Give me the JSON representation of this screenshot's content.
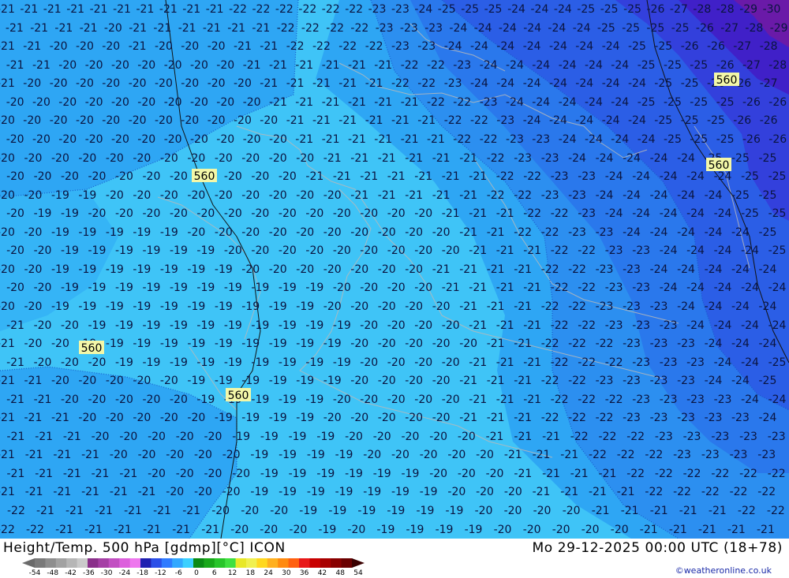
{
  "map": {
    "pressure_labels": [
      "560",
      "560",
      "560",
      "560",
      "560"
    ],
    "field_rows": [
      {
        "values": [
          -21,
          -21,
          -21,
          -21,
          -21,
          -21,
          -21,
          -21,
          -21,
          -21,
          -22,
          -22,
          -22,
          -22,
          -22,
          -22,
          -23,
          -23,
          -24,
          -25,
          -25,
          -25,
          -24,
          -24,
          -24,
          -25,
          -25,
          -25,
          -26,
          -27,
          -28,
          -28,
          -29,
          -30
        ]
      },
      {
        "values": [
          -21,
          -21,
          -21,
          -21,
          -20,
          -21,
          -21,
          -21,
          -21,
          -21,
          -21,
          -22,
          -22,
          -22,
          -22,
          -23,
          -23,
          -23,
          -24,
          -24,
          -24,
          -24,
          -24,
          -24,
          -25,
          -25,
          -25,
          -25,
          -26,
          -27,
          -28,
          -29
        ]
      },
      {
        "values": [
          -21,
          -21,
          -20,
          -20,
          -20,
          -21,
          -20,
          -20,
          -20,
          -21,
          -21,
          -22,
          -22,
          -22,
          -22,
          -23,
          -23,
          -24,
          -24,
          -24,
          -24,
          -24,
          -24,
          -24,
          -25,
          -25,
          -26,
          -26,
          -27,
          -28
        ]
      },
      {
        "values": [
          -21,
          -21,
          -20,
          -20,
          -20,
          -20,
          -20,
          -20,
          -20,
          -21,
          -21,
          -21,
          -21,
          -21,
          -21,
          -22,
          -22,
          -23,
          -24,
          -24,
          -24,
          -24,
          -24,
          -24,
          -25,
          -25,
          -25,
          -26,
          -27,
          -28
        ]
      },
      {
        "values": [
          -21,
          -20,
          -20,
          -20,
          -20,
          -20,
          -20,
          -20,
          -20,
          -20,
          -21,
          -21,
          -21,
          -21,
          -21,
          -22,
          -22,
          -23,
          -24,
          -24,
          -24,
          -24,
          -24,
          -24,
          -24,
          -25,
          -25,
          -26,
          -26,
          -27
        ]
      },
      {
        "values": [
          -20,
          -20,
          -20,
          -20,
          -20,
          -20,
          -20,
          -20,
          -20,
          -20,
          -21,
          -21,
          -21,
          -21,
          -21,
          -21,
          -22,
          -22,
          -23,
          -24,
          -24,
          -24,
          -24,
          -24,
          -25,
          -25,
          -25,
          -25,
          -26,
          -26
        ]
      },
      {
        "values": [
          -20,
          -20,
          -20,
          -20,
          -20,
          -20,
          -20,
          -20,
          -20,
          -20,
          -20,
          -21,
          -21,
          -21,
          -21,
          -21,
          -21,
          -22,
          -22,
          -23,
          -24,
          -24,
          -24,
          -24,
          -24,
          -25,
          -25,
          -25,
          -26,
          -26
        ]
      },
      {
        "values": [
          -20,
          -20,
          -20,
          -20,
          -20,
          -20,
          -20,
          -20,
          -20,
          -20,
          -20,
          -21,
          -21,
          -21,
          -21,
          -21,
          -21,
          -22,
          -22,
          -23,
          -23,
          -24,
          -24,
          -24,
          -24,
          -25,
          -25,
          -25,
          -26,
          -26
        ]
      },
      {
        "values": [
          -20,
          -20,
          -20,
          -20,
          -20,
          -20,
          -20,
          -20,
          -20,
          -20,
          -20,
          -20,
          -21,
          -21,
          -21,
          -21,
          -21,
          -21,
          -22,
          -23,
          -23,
          -24,
          -24,
          -24,
          -24,
          -24,
          -25,
          -25,
          -25
        ]
      },
      {
        "values": [
          -20,
          -20,
          -20,
          -20,
          -20,
          -20,
          -20,
          -20,
          -20,
          -20,
          -20,
          -21,
          -21,
          -21,
          -21,
          -21,
          -21,
          -21,
          -22,
          -22,
          -23,
          -23,
          -24,
          -24,
          -24,
          -24,
          -24,
          -25,
          -25
        ]
      },
      {
        "values": [
          -20,
          -20,
          -19,
          -19,
          -20,
          -20,
          -20,
          -20,
          -20,
          -20,
          -20,
          -20,
          -20,
          -21,
          -21,
          -21,
          -21,
          -21,
          -22,
          -22,
          -23,
          -23,
          -24,
          -24,
          -24,
          -24,
          -24,
          -25,
          -25
        ]
      },
      {
        "values": [
          -20,
          -19,
          -19,
          -20,
          -20,
          -20,
          -20,
          -20,
          -20,
          -20,
          -20,
          -20,
          -20,
          -20,
          -20,
          -20,
          -21,
          -21,
          -21,
          -22,
          -22,
          -23,
          -24,
          -24,
          -24,
          -24,
          -24,
          -25,
          -25
        ]
      },
      {
        "values": [
          -20,
          -20,
          -19,
          -19,
          -19,
          -19,
          -19,
          -20,
          -20,
          -20,
          -20,
          -20,
          -20,
          -20,
          -20,
          -20,
          -20,
          -21,
          -21,
          -22,
          -22,
          -23,
          -23,
          -24,
          -24,
          -24,
          -24,
          -24,
          -25
        ]
      },
      {
        "values": [
          -20,
          -20,
          -19,
          -19,
          -19,
          -19,
          -19,
          -19,
          -20,
          -20,
          -20,
          -20,
          -20,
          -20,
          -20,
          -20,
          -20,
          -21,
          -21,
          -21,
          -22,
          -22,
          -23,
          -23,
          -24,
          -24,
          -24,
          -24,
          -25
        ]
      },
      {
        "values": [
          -20,
          -20,
          -19,
          -19,
          -19,
          -19,
          -19,
          -19,
          -19,
          -20,
          -20,
          -20,
          -20,
          -20,
          -20,
          -20,
          -21,
          -21,
          -21,
          -21,
          -22,
          -22,
          -23,
          -23,
          -24,
          -24,
          -24,
          -24,
          -24
        ]
      },
      {
        "values": [
          -20,
          -20,
          -19,
          -19,
          -19,
          -19,
          -19,
          -19,
          -19,
          -19,
          -19,
          -19,
          -20,
          -20,
          -20,
          -20,
          -21,
          -21,
          -21,
          -21,
          -22,
          -22,
          -23,
          -23,
          -24,
          -24,
          -24,
          -24,
          -24
        ]
      },
      {
        "values": [
          -20,
          -20,
          -19,
          -19,
          -19,
          -19,
          -19,
          -19,
          -19,
          -19,
          -19,
          -19,
          -20,
          -20,
          -20,
          -20,
          -20,
          -21,
          -21,
          -21,
          -22,
          -22,
          -23,
          -23,
          -23,
          -24,
          -24,
          -24,
          -24
        ]
      },
      {
        "values": [
          -21,
          -20,
          -20,
          -19,
          -19,
          -19,
          -19,
          -19,
          -19,
          -19,
          -19,
          -19,
          -19,
          -20,
          -20,
          -20,
          -20,
          -21,
          -21,
          -21,
          -22,
          -22,
          -23,
          -23,
          -23,
          -24,
          -24,
          -24,
          -24
        ]
      },
      {
        "values": [
          -21,
          -20,
          -20,
          -19,
          -19,
          -19,
          -19,
          -19,
          -19,
          -19,
          -19,
          -19,
          -19,
          -20,
          -20,
          -20,
          -20,
          -20,
          -21,
          -21,
          -22,
          -22,
          -22,
          -23,
          -23,
          -23,
          -24,
          -24,
          -24
        ]
      },
      {
        "values": [
          -21,
          -20,
          -20,
          -20,
          -19,
          -19,
          -19,
          -19,
          -19,
          -19,
          -19,
          -19,
          -19,
          -20,
          -20,
          -20,
          -20,
          -21,
          -21,
          -21,
          -22,
          -22,
          -22,
          -23,
          -23,
          -23,
          -24,
          -24,
          -25
        ]
      },
      {
        "values": [
          -21,
          -21,
          -20,
          -20,
          -20,
          -20,
          -20,
          -19,
          -19,
          -19,
          -19,
          -19,
          -19,
          -20,
          -20,
          -20,
          -20,
          -21,
          -21,
          -21,
          -22,
          -22,
          -23,
          -23,
          -23,
          -23,
          -24,
          -24,
          -25
        ]
      },
      {
        "values": [
          -21,
          -21,
          -20,
          -20,
          -20,
          -20,
          -20,
          -19,
          -19,
          -19,
          -19,
          -19,
          -20,
          -20,
          -20,
          -20,
          -20,
          -21,
          -21,
          -21,
          -22,
          -22,
          -22,
          -23,
          -23,
          -23,
          -23,
          -24,
          -24
        ]
      },
      {
        "values": [
          -21,
          -21,
          -21,
          -20,
          -20,
          -20,
          -20,
          -20,
          -19,
          -19,
          -19,
          -19,
          -20,
          -20,
          -20,
          -20,
          -20,
          -21,
          -21,
          -21,
          -22,
          -22,
          -22,
          -23,
          -23,
          -23,
          -23,
          -23,
          -24
        ]
      },
      {
        "values": [
          -21,
          -21,
          -21,
          -20,
          -20,
          -20,
          -20,
          -20,
          -19,
          -19,
          -19,
          -19,
          -20,
          -20,
          -20,
          -20,
          -20,
          -21,
          -21,
          -21,
          -22,
          -22,
          -22,
          -23,
          -23,
          -23,
          -23,
          -23
        ]
      },
      {
        "values": [
          -21,
          -21,
          -21,
          -21,
          -20,
          -20,
          -20,
          -20,
          -20,
          -19,
          -19,
          -19,
          -19,
          -20,
          -20,
          -20,
          -20,
          -20,
          -21,
          -21,
          -21,
          -22,
          -22,
          -22,
          -23,
          -23,
          -23,
          -23
        ]
      },
      {
        "values": [
          -21,
          -21,
          -21,
          -21,
          -21,
          -20,
          -20,
          -20,
          -20,
          -19,
          -19,
          -19,
          -19,
          -19,
          -19,
          -20,
          -20,
          -20,
          -21,
          -21,
          -21,
          -21,
          -22,
          -22,
          -22,
          -22,
          -22,
          -22
        ]
      },
      {
        "values": [
          -21,
          -21,
          -21,
          -21,
          -21,
          -21,
          -20,
          -20,
          -20,
          -19,
          -19,
          -19,
          -19,
          -19,
          -19,
          -19,
          -20,
          -20,
          -20,
          -21,
          -21,
          -21,
          -21,
          -22,
          -22,
          -22,
          -22,
          -22
        ]
      },
      {
        "values": [
          -22,
          -21,
          -21,
          -21,
          -21,
          -21,
          -21,
          -20,
          -20,
          -20,
          -19,
          -19,
          -19,
          -19,
          -19,
          -19,
          -20,
          -20,
          -20,
          -20,
          -21,
          -21,
          -21,
          -21,
          -21,
          -22,
          -22
        ]
      },
      {
        "values": [
          -22,
          -22,
          -21,
          -21,
          -21,
          -21,
          -21,
          -21,
          -20,
          -20,
          -20,
          -19,
          -20,
          -19,
          -19,
          -19,
          -19,
          -20,
          -20,
          -20,
          -20,
          -20,
          -21,
          -21,
          -21,
          -21,
          -21
        ]
      }
    ]
  },
  "footer": {
    "title_left": "Height/Temp. 500 hPa [gdmp][°C] ICON",
    "title_right": "Mo 29-12-2025 00:00 UTC (18+78)",
    "credit": "©weatheronline.co.uk",
    "scale_ticks": [
      "-54",
      "-48",
      "-42",
      "-36",
      "-30",
      "-24",
      "-18",
      "-12",
      "-6",
      "0",
      "6",
      "12",
      "18",
      "24",
      "30",
      "36",
      "42",
      "48",
      "54"
    ],
    "scale_colors": [
      "#7a7a7a",
      "#8e8e8e",
      "#a2a2a2",
      "#b6b6b6",
      "#cacaca",
      "#8a2f8a",
      "#a53fa5",
      "#c24fc2",
      "#dc5fdc",
      "#ee77ee",
      "#2020b0",
      "#2b4fe8",
      "#2f7bff",
      "#32a8ff",
      "#3bd0ff",
      "#0a8a14",
      "#18a81a",
      "#28c52a",
      "#40e040",
      "#e8e828",
      "#f0f050",
      "#ffd820",
      "#ffb020",
      "#ff8a10",
      "#ff6010",
      "#e81818",
      "#c80000",
      "#a80000",
      "#880000",
      "#6a0000"
    ]
  }
}
